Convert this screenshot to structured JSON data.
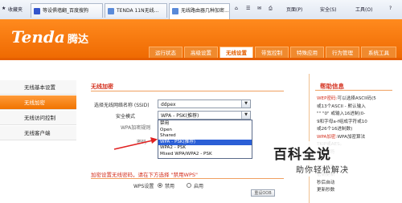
{
  "browser": {
    "tabs": [
      {
        "label": "收藏夹"
      },
      {
        "label": "等设俱墙翻_百度搜狗"
      },
      {
        "label": "TENDA 11N无线..."
      },
      {
        "label": "无线路由器几种加密..."
      }
    ],
    "toolbar": {
      "page": "页面(P)",
      "safety": "安全(S)",
      "tools": "工具(O)",
      "help_icon": "?"
    }
  },
  "router": {
    "logo": "Tenda",
    "logo_cn": "腾达",
    "nav": [
      "运行状态",
      "高级设置",
      "无线设置",
      "带宽控制",
      "特殊应用",
      "行为管理",
      "系统工具"
    ],
    "left_menu": [
      "无线基本设置",
      "无线加密",
      "无线访问控制",
      "无线客户端"
    ],
    "content_title": "无线加密",
    "ssid_label": "选择无线网络名称 (SSID)",
    "ssid_value": "ddpex",
    "security_label": "安全模式",
    "security_value": "WPA - PSK(推荐)",
    "wpa_label": "WPA加密规则",
    "key_label": "密码",
    "dropdown_options": [
      "禁用",
      "Open",
      "Shared",
      "WPA - PSK(推荐)",
      "WPA2 - PSK",
      "Mixed WPA/WPA2 - PSK"
    ],
    "selected_index": 3,
    "hint": "加密设置无线密码，请在下方选择 \"禁用WPS\"",
    "wps_label": "WPS设置",
    "wps_options": [
      "禁用",
      "启用"
    ],
    "reset_button": "重设OOB",
    "help_title": "帮助信息",
    "help_lines": [
      {
        "red": "WEP密码:",
        "text": "可以选择ASCII码(5"
      },
      {
        "red": "",
        "text": "或13个ASCII - 默认输入"
      },
      {
        "red": "",
        "text": "\"\" \"0\" 或输入16进制(0-"
      },
      {
        "red": "",
        "text": "9和字母a-f组成字符或10"
      },
      {
        "red": "",
        "text": "或26个16进制数)"
      },
      {
        "red": "WPA加密:",
        "text": "WPA加密算法"
      },
      {
        "red": "",
        "text": "TKIP或AES。"
      },
      {
        "red": "",
        "text": "组成字符"
      },
      {
        "red": "",
        "text": "或64个"
      },
      {
        "red": "",
        "text": "AES加密"
      },
      {
        "red": "",
        "text": "密钥更新"
      },
      {
        "red": "",
        "text": "秒后自动"
      },
      {
        "red": "",
        "text": "更新秒数"
      }
    ]
  },
  "watermark": {
    "title": "百科全说",
    "subtitle": "助你轻松解决"
  },
  "colors": {
    "brand_orange": "#ef6a02",
    "accent_red": "#d32f1d",
    "select_blue": "#2b5fd6"
  }
}
